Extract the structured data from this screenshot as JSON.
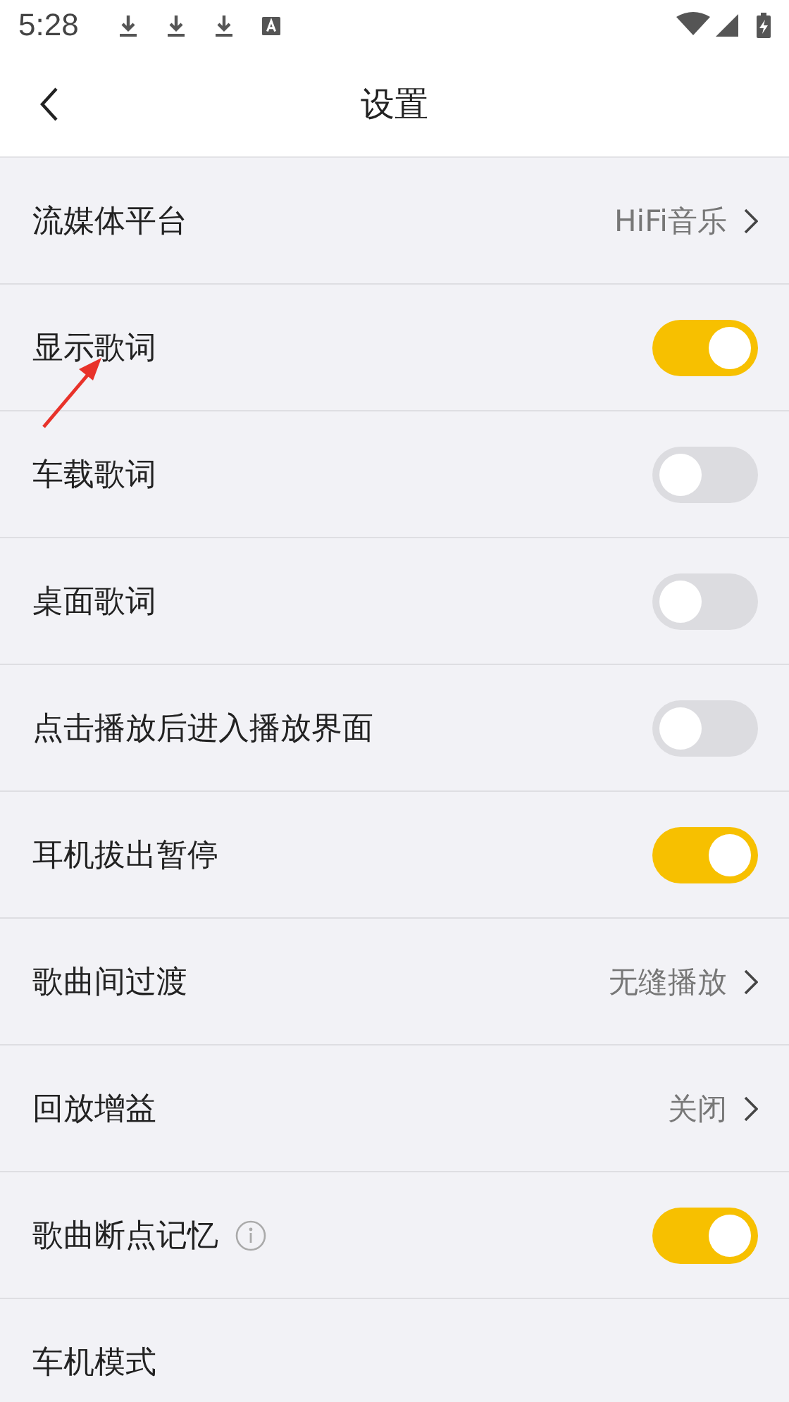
{
  "status_bar": {
    "time": "5:28"
  },
  "header": {
    "title": "设置"
  },
  "rows": [
    {
      "kind": "link",
      "label": "流媒体平台",
      "value": "HiFi音乐"
    },
    {
      "kind": "toggle",
      "label": "显示歌词",
      "on": true
    },
    {
      "kind": "toggle",
      "label": "车载歌词",
      "on": false
    },
    {
      "kind": "toggle",
      "label": "桌面歌词",
      "on": false
    },
    {
      "kind": "toggle",
      "label": "点击播放后进入播放界面",
      "on": false
    },
    {
      "kind": "toggle",
      "label": "耳机拔出暂停",
      "on": true
    },
    {
      "kind": "link",
      "label": "歌曲间过渡",
      "value": "无缝播放"
    },
    {
      "kind": "link",
      "label": "回放增益",
      "value": "关闭"
    },
    {
      "kind": "toggle",
      "label": "歌曲断点记忆",
      "on": true,
      "info_icon": true
    },
    {
      "kind": "plain",
      "label": "车机模式"
    }
  ]
}
